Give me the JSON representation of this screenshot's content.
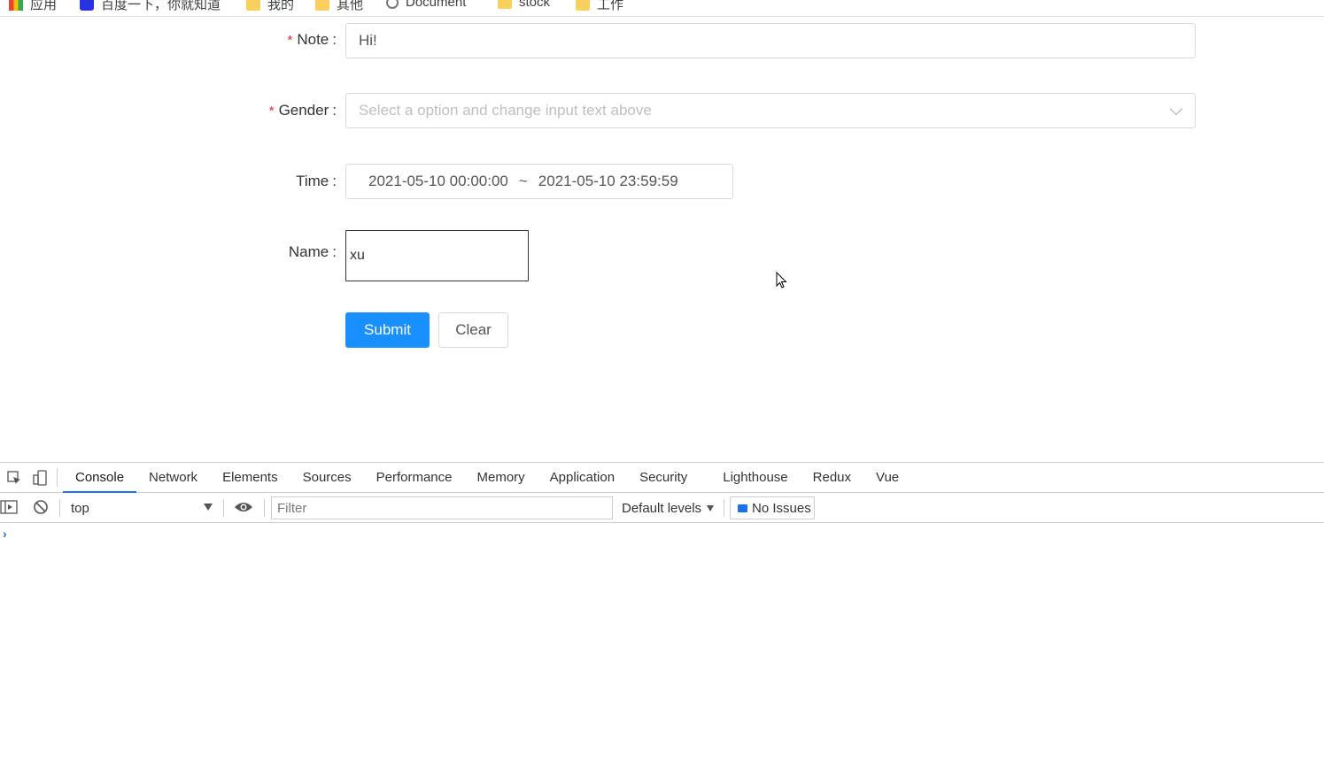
{
  "bookmarks": [
    {
      "label": "应用",
      "icon": "apps-icon"
    },
    {
      "label": "百度一下，你就知道",
      "icon": "baidu-icon"
    },
    {
      "label": "我的",
      "icon": "folder-icon"
    },
    {
      "label": "其他",
      "icon": "folder-icon"
    },
    {
      "label": "Document",
      "icon": "globe-icon"
    },
    {
      "label": "stock",
      "icon": "folder-icon"
    },
    {
      "label": "工作",
      "icon": "folder-icon"
    }
  ],
  "form": {
    "note": {
      "label": "Note",
      "value": "Hi!",
      "required": true
    },
    "gender": {
      "label": "Gender",
      "placeholder": "Select a option and change input text above",
      "required": true
    },
    "time": {
      "label": "Time",
      "start": "2021-05-10 00:00:00",
      "separator": "~",
      "end": "2021-05-10 23:59:59"
    },
    "name": {
      "label": "Name",
      "value": "xu"
    },
    "colon": ":",
    "submit_label": "Submit",
    "clear_label": "Clear"
  },
  "devtools": {
    "tabs": [
      "Console",
      "Network",
      "Elements",
      "Sources",
      "Performance",
      "Memory",
      "Application",
      "Security",
      "Lighthouse",
      "Redux",
      "Vue"
    ],
    "active_tab": "Console",
    "context": "top",
    "filter_placeholder": "Filter",
    "levels_label": "Default levels",
    "issues_label": "No Issues",
    "prompt": "›"
  },
  "colors": {
    "primary": "#1890ff",
    "required": "#f5222d",
    "devtools_accent": "#1a73e8"
  }
}
